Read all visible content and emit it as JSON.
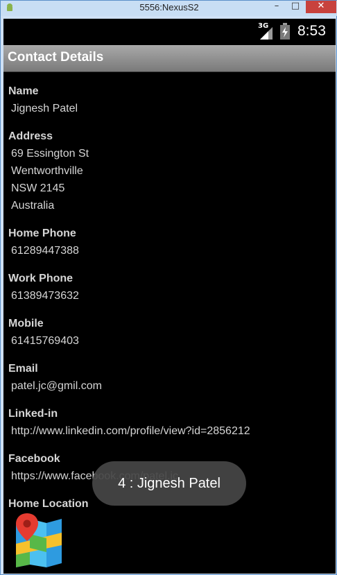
{
  "window": {
    "title": "5556:NexusS2",
    "minimize_glyph": "–",
    "maximize_glyph": "□",
    "close_glyph": "✕"
  },
  "statusbar": {
    "network": "3G",
    "time": "8:53"
  },
  "actionbar": {
    "title": "Contact Details"
  },
  "contact": {
    "name_label": "Name",
    "name": "Jignesh Patel",
    "address_label": "Address",
    "address_lines": [
      "69 Essington St",
      "Wentworthville",
      "NSW 2145",
      "Australia"
    ],
    "home_phone_label": "Home Phone",
    "home_phone": "61289447388",
    "work_phone_label": "Work Phone",
    "work_phone": "61389473632",
    "mobile_label": "Mobile",
    "mobile": "61415769403",
    "email_label": "Email",
    "email": "patel.jc@gmil.com",
    "linkedin_label": "Linked-in",
    "linkedin": "http://www.linkedin.com/profile/view?id=2856212",
    "facebook_label": "Facebook",
    "facebook": "https://www.facebook.com/patel.jc",
    "home_location_label": "Home Location"
  },
  "toast": {
    "text": "4 : Jignesh Patel"
  },
  "icons": {
    "app": "android-icon",
    "signal": "signal-icon",
    "battery": "battery-icon",
    "map": "map-icon"
  },
  "colors": {
    "screen_bg": "#000000",
    "actionbar_bg": "#8a8a8a",
    "text": "#d6d6d6",
    "toast_bg": "#464646",
    "close_button": "#c8423d"
  }
}
